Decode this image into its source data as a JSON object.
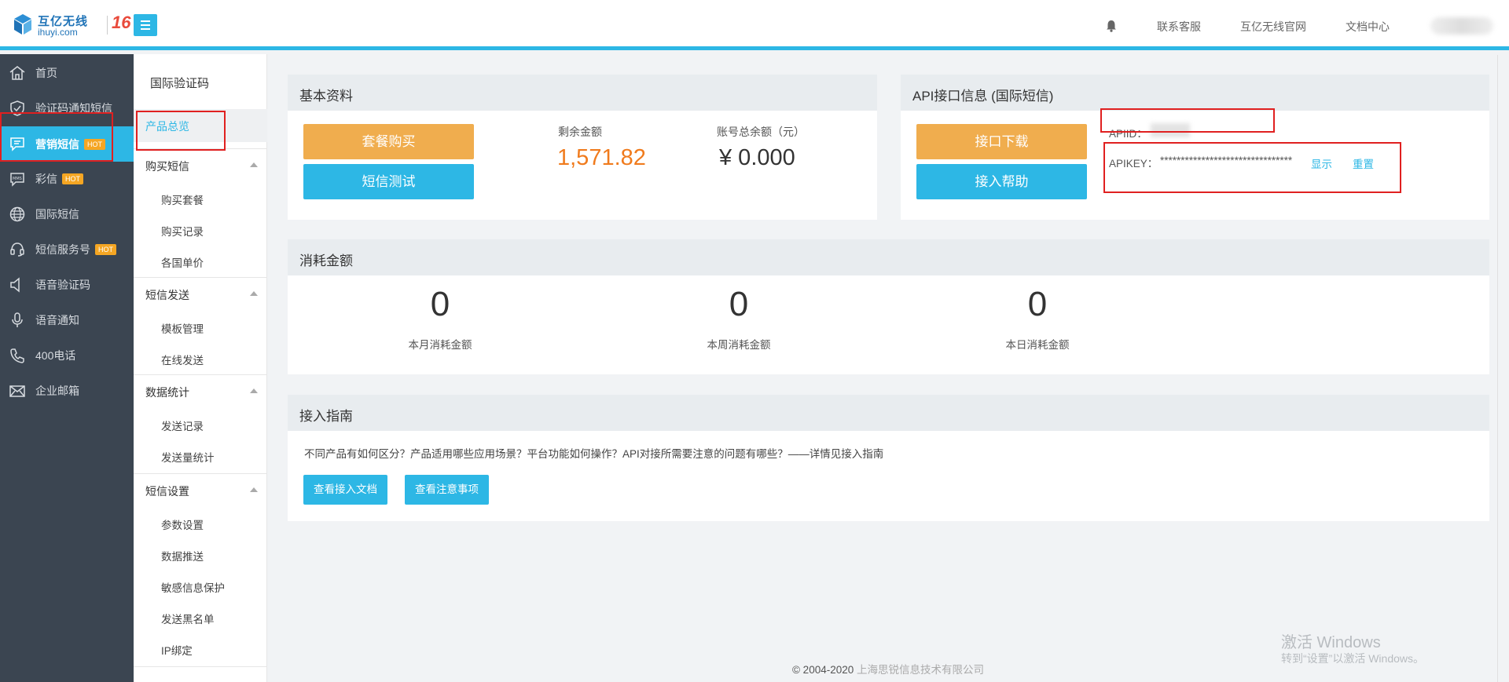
{
  "brand": {
    "name_cn": "互亿无线",
    "name_en": "ihuyi.com",
    "anniversary": "16"
  },
  "header": {
    "links": [
      "联系客服",
      "互亿无线官网",
      "文档中心"
    ]
  },
  "sidebar": {
    "items": [
      {
        "label": "首页",
        "icon": "home-icon",
        "hot": ""
      },
      {
        "label": "验证码通知短信",
        "icon": "shield-check-icon",
        "hot": ""
      },
      {
        "label": "营销短信",
        "icon": "message-icon",
        "hot": "HOT"
      },
      {
        "label": "彩信",
        "icon": "mms-icon",
        "hot": "HOT"
      },
      {
        "label": "国际短信",
        "icon": "globe-icon",
        "hot": ""
      },
      {
        "label": "短信服务号",
        "icon": "headset-icon",
        "hot": "HOT"
      },
      {
        "label": "语音验证码",
        "icon": "speaker-icon",
        "hot": ""
      },
      {
        "label": "语音通知",
        "icon": "microphone-icon",
        "hot": ""
      },
      {
        "label": "400电话",
        "icon": "phone-icon",
        "hot": ""
      },
      {
        "label": "企业邮箱",
        "icon": "mail-icon",
        "hot": ""
      }
    ]
  },
  "subnav": {
    "title": "国际验证码",
    "active": "产品总览",
    "groups": [
      {
        "label": "购买短信",
        "items": [
          "购买套餐",
          "购买记录",
          "各国单价"
        ]
      },
      {
        "label": "短信发送",
        "items": [
          "模板管理",
          "在线发送"
        ]
      },
      {
        "label": "数据统计",
        "items": [
          "发送记录",
          "发送量统计"
        ]
      },
      {
        "label": "短信设置",
        "items": [
          "参数设置",
          "数据推送",
          "敏感信息保护",
          "发送黑名单",
          "IP绑定"
        ]
      }
    ]
  },
  "basic": {
    "title": "基本资料",
    "btn_buy": "套餐购买",
    "btn_test": "短信测试",
    "balance_label": "剩余金额",
    "balance_value": "1,571.82",
    "account_label": "账号总余额（元）",
    "account_value": "¥ 0.000"
  },
  "api": {
    "title": "API接口信息 (国际短信)",
    "btn_download": "接口下载",
    "btn_help": "接入帮助",
    "apiid_label": "APIID：",
    "apikey_label": "APIKEY：",
    "apikey_value": "********************************",
    "show": "显示",
    "reset": "重置"
  },
  "consumption": {
    "title": "消耗金额",
    "stats": [
      {
        "value": "0",
        "label": "本月消耗金额"
      },
      {
        "value": "0",
        "label": "本周消耗金额"
      },
      {
        "value": "0",
        "label": "本日消耗金额"
      }
    ]
  },
  "guide": {
    "title": "接入指南",
    "text": "不同产品有如何区分？产品适用哪些应用场景？平台功能如何操作？API对接所需要注意的问题有哪些？——详情见接入指南",
    "btn_docs": "查看接入文档",
    "btn_notes": "查看注意事项"
  },
  "footer": {
    "copyright": "© 2004-2020",
    "company": "上海思锐信息技术有限公司"
  },
  "watermark": {
    "line1": "激活 Windows",
    "line2": "转到“设置”以激活 Windows。"
  },
  "colors": {
    "accent": "#2db7e5",
    "orange": "#f0ad4e",
    "balance": "#f07b1d",
    "sidebar": "#3b4551"
  }
}
